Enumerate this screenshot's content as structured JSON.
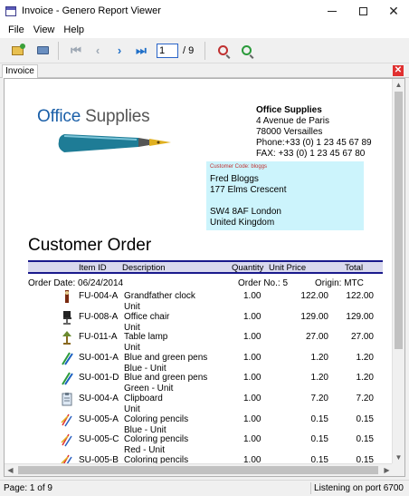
{
  "window": {
    "title": "Invoice - Genero Report Viewer"
  },
  "menu": [
    "File",
    "View",
    "Help"
  ],
  "toolbar": {
    "page_value": "1",
    "page_total": "/ 9"
  },
  "tab": {
    "label": "Invoice"
  },
  "report": {
    "logo_part1": "Office",
    "logo_part2": " Supplies",
    "company": {
      "name": "Office Supplies",
      "street": "4 Avenue de Paris",
      "city": "78000 Versailles",
      "phone": "Phone:+33 (0) 1 23 45 67 89",
      "fax": "FAX:   +33 (0) 1 23 45 67 80"
    },
    "customer": {
      "code_label": "Customer Code:  bloggs",
      "name": "Fred Bloggs",
      "street": "177 Elms Crescent",
      "postcode_city": "SW4 8AF London",
      "country": "United Kingdom"
    },
    "title": "Customer Order",
    "columns": [
      "Item ID",
      "Description",
      "Quantity",
      "Unit Price",
      "Total"
    ],
    "order_date": "Order Date: 06/24/2014",
    "order_no": "Order No.:   5",
    "origin": "Origin:  MTC",
    "items": [
      {
        "id": "FU-004-A",
        "desc": "Grandfather clock",
        "unit": "Unit",
        "qty": "1.00",
        "price": "122.00",
        "total": "122.00",
        "icon": "clock-icon"
      },
      {
        "id": "FU-008-A",
        "desc": "Office chair",
        "unit": "Unit",
        "qty": "1.00",
        "price": "129.00",
        "total": "129.00",
        "icon": "chair-icon"
      },
      {
        "id": "FU-011-A",
        "desc": "Table lamp",
        "unit": "Unit",
        "qty": "1.00",
        "price": "27.00",
        "total": "27.00",
        "icon": "lamp-icon"
      },
      {
        "id": "SU-001-A",
        "desc": "Blue and green pens",
        "unit": "Blue - Unit",
        "qty": "1.00",
        "price": "1.20",
        "total": "1.20",
        "icon": "pens-icon"
      },
      {
        "id": "SU-001-D",
        "desc": "Blue and green pens",
        "unit": "Green - Unit",
        "qty": "1.00",
        "price": "1.20",
        "total": "1.20",
        "icon": "pens-icon"
      },
      {
        "id": "SU-004-A",
        "desc": "Clipboard",
        "unit": "Unit",
        "qty": "1.00",
        "price": "7.20",
        "total": "7.20",
        "icon": "clipboard-icon"
      },
      {
        "id": "SU-005-A",
        "desc": "Coloring pencils",
        "unit": "Blue - Unit",
        "qty": "1.00",
        "price": "0.15",
        "total": "0.15",
        "icon": "pencils-icon"
      },
      {
        "id": "SU-005-C",
        "desc": "Coloring pencils",
        "unit": "Red - Unit",
        "qty": "1.00",
        "price": "0.15",
        "total": "0.15",
        "icon": "pencils-icon"
      },
      {
        "id": "SU-005-B",
        "desc": "Coloring pencils",
        "unit": "",
        "qty": "1.00",
        "price": "0.15",
        "total": "0.15",
        "icon": "pencils-icon"
      }
    ]
  },
  "status": {
    "left": "Page: 1 of 9",
    "right": "Listening on port 6700"
  }
}
